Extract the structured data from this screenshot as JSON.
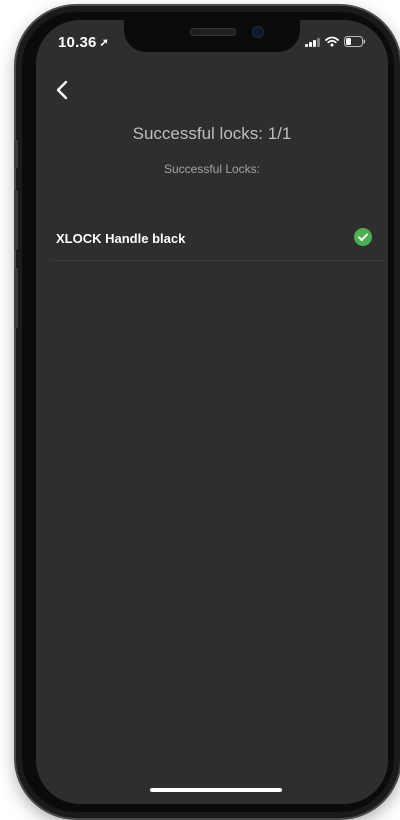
{
  "status_bar": {
    "time": "10.36",
    "location_icon": "location-arrow-icon",
    "signal_icon": "cellular-signal-icon",
    "wifi_icon": "wifi-icon",
    "battery_icon": "battery-icon"
  },
  "nav": {
    "back_icon": "chevron-left-icon"
  },
  "header": {
    "title": "Successful locks: 1/1",
    "subtitle": "Successful Locks:"
  },
  "locks": [
    {
      "name": "XLOCK Handle black",
      "status_icon": "check-circle-icon"
    }
  ],
  "colors": {
    "screen_background": "#2e2e2e",
    "success": "#4caf50",
    "title_text": "#bdbdbd",
    "list_text": "#ffffff"
  }
}
